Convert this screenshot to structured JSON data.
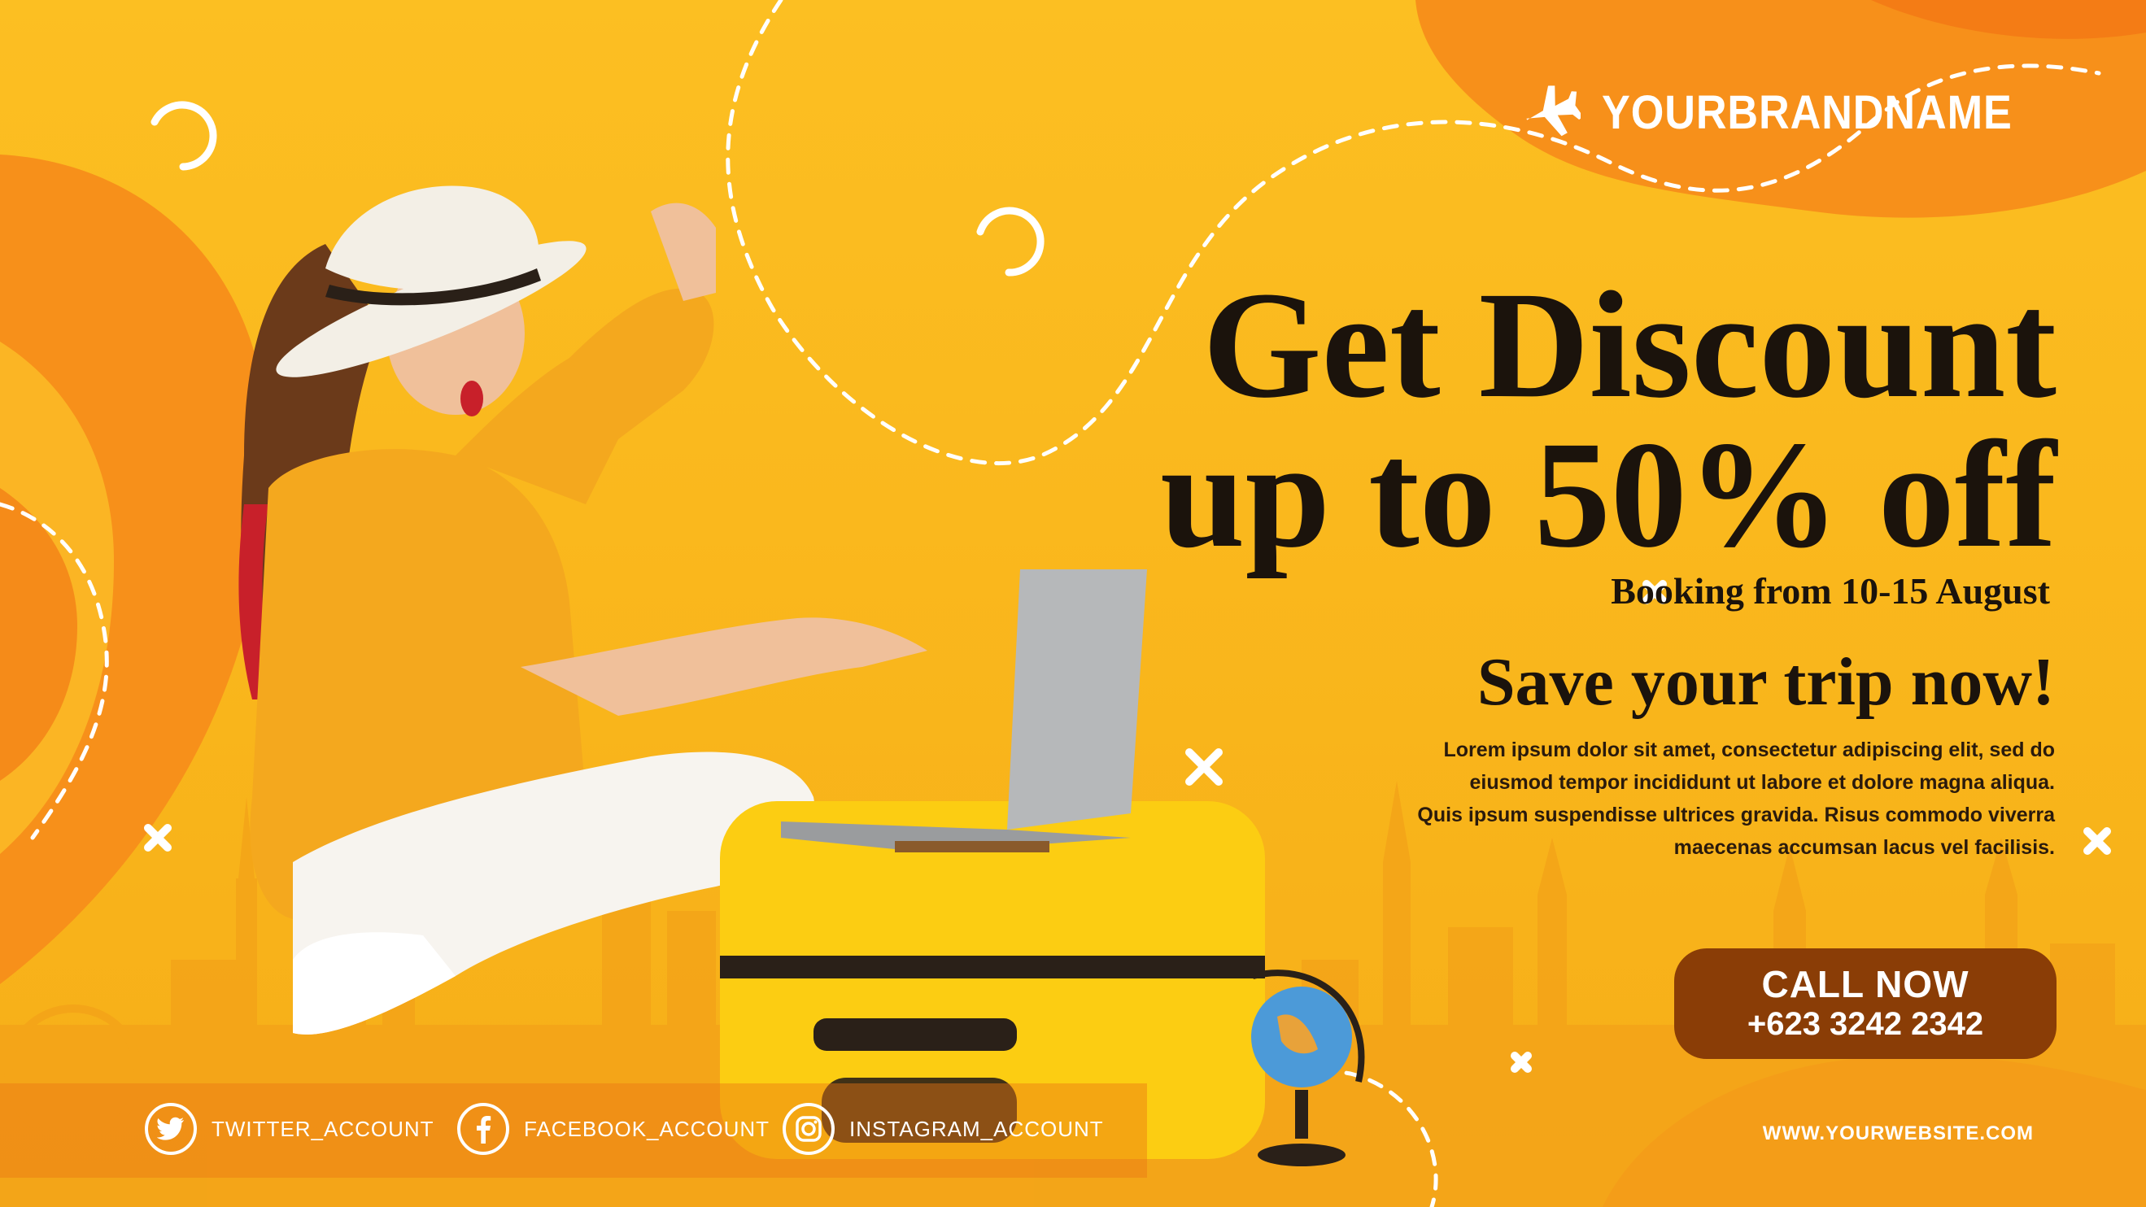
{
  "brand": {
    "name": "YOURBRANDNAME",
    "icon": "airplane-icon"
  },
  "headline": {
    "line1": "Get Discount",
    "line2": "up to 50% off"
  },
  "booking_text": "Booking from 10-15  August",
  "tagline": "Save your trip now!",
  "body_lines": [
    "Lorem ipsum dolor sit amet, consectetur adipiscing elit, sed do",
    "eiusmod tempor incididunt ut labore et dolore magna aliqua.",
    "Quis ipsum suspendisse ultrices gravida. Risus commodo viverra",
    "maecenas accumsan lacus vel facilisis."
  ],
  "cta": {
    "label": "CALL NOW",
    "phone": "+623 3242 2342"
  },
  "website": "WWW.YOURWEBSITE.COM",
  "social": [
    {
      "icon": "twitter-icon",
      "label": "TWITTER_ACCOUNT"
    },
    {
      "icon": "facebook-icon",
      "label": "FACEBOOK_ACCOUNT"
    },
    {
      "icon": "instagram-icon",
      "label": "INSTAGRAM_ACCOUNT"
    }
  ],
  "colors": {
    "background": "#f9b51b",
    "accent_orange": "#f7901a",
    "deep_orange": "#f26f12",
    "text_dark": "#1b130c",
    "cta_brown": "#8a3d06",
    "white": "#ffffff"
  }
}
